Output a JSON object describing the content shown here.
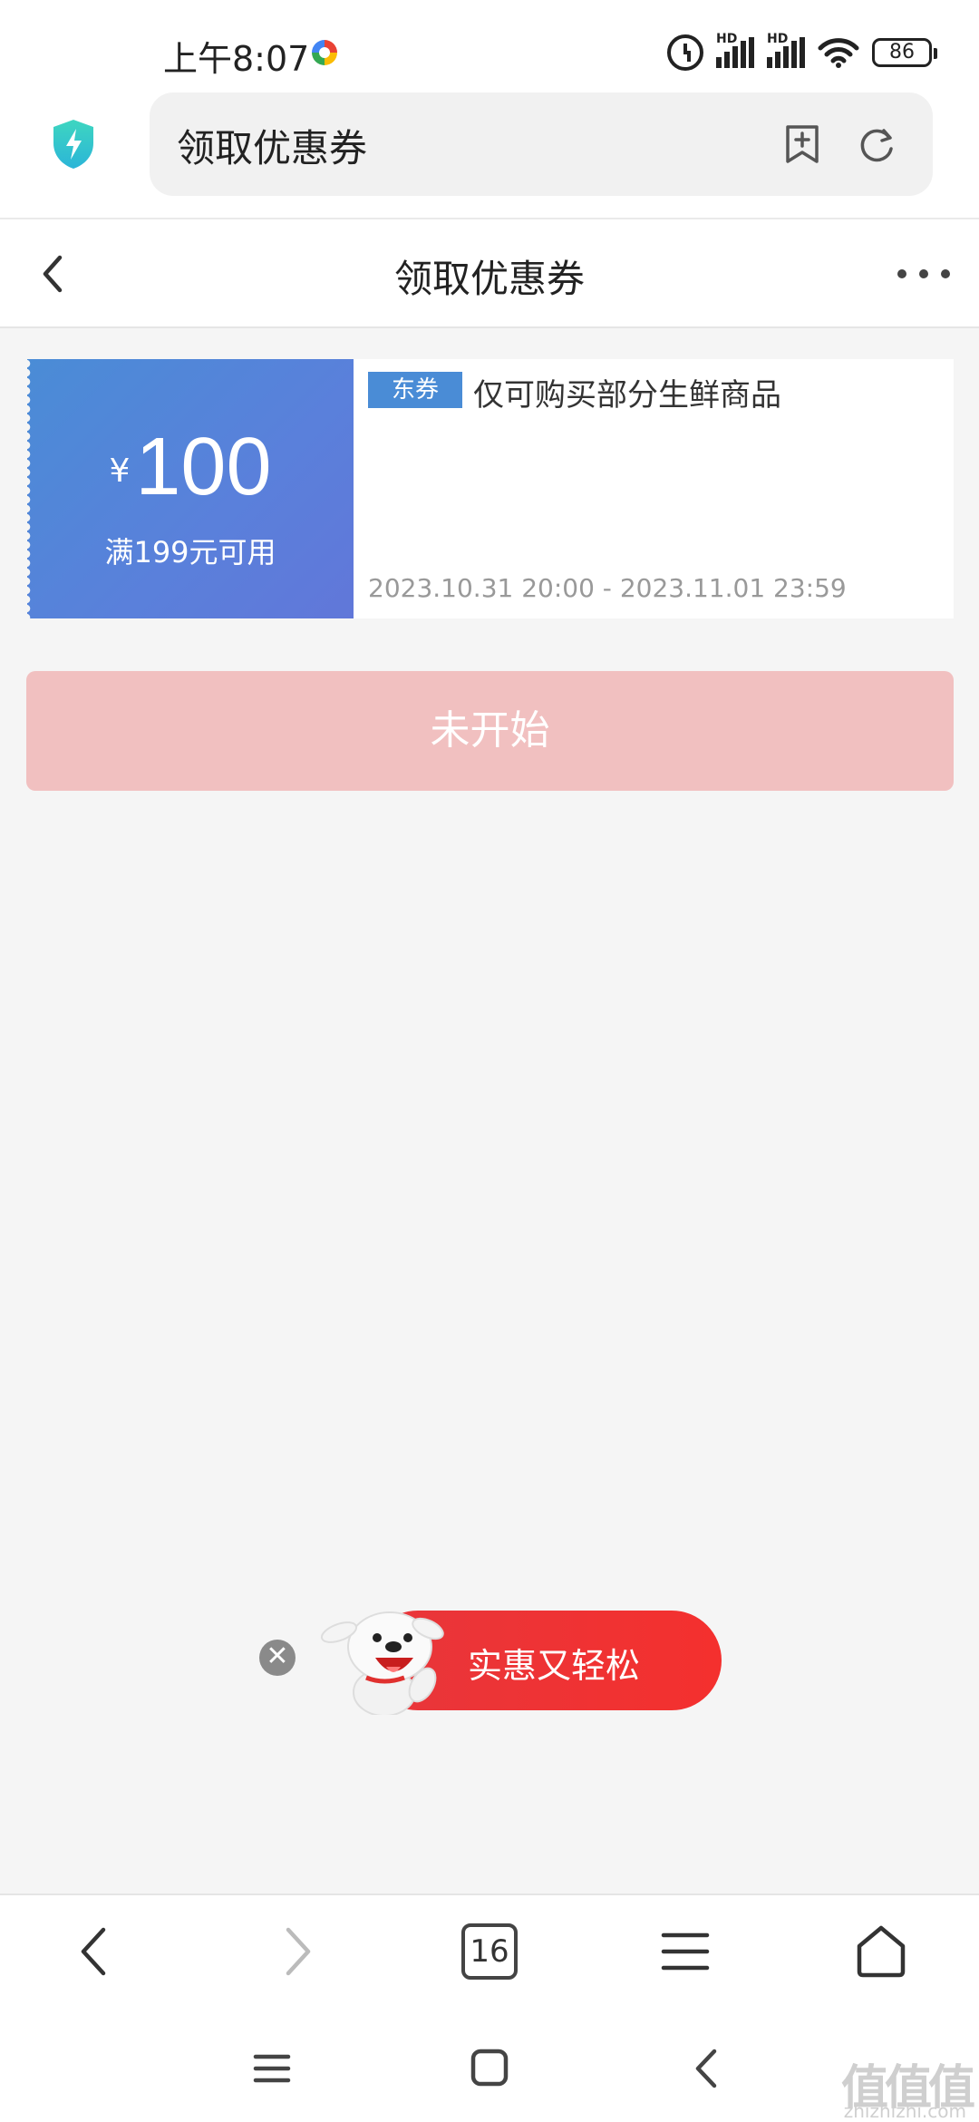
{
  "status_bar": {
    "time": "上午8:07",
    "battery": "86",
    "signal_label": "HD"
  },
  "browser": {
    "url_title": "领取优惠券"
  },
  "header": {
    "title": "领取优惠券"
  },
  "coupon": {
    "currency": "¥",
    "amount": "100",
    "condition": "满199元可用",
    "tag": "东券",
    "description": "仅可购买部分生鲜商品",
    "valid_period": "2023.10.31 20:00 - 2023.11.01 23:59",
    "color": "#4a8cd6"
  },
  "action": {
    "status_label": "未开始",
    "color": "#f1c0c0"
  },
  "promo": {
    "text": "实惠又轻松",
    "close_glyph": "✕",
    "color": "#f4302e"
  },
  "toolbar": {
    "tabs_count": "16"
  },
  "watermark": {
    "text": "值值值",
    "sub": "zhizhizhi.com"
  }
}
